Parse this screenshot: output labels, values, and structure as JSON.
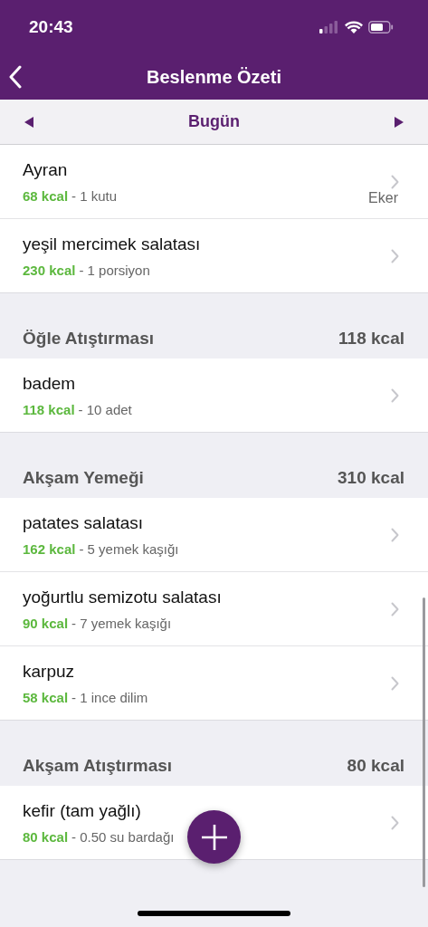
{
  "status_bar": {
    "time": "20:43"
  },
  "nav": {
    "title": "Beslenme Özeti"
  },
  "date_bar": {
    "label": "Bugün"
  },
  "sections": [
    {
      "items": [
        {
          "name": "Ayran",
          "kcal": "68 kcal",
          "serving": "- 1 kutu",
          "note": "Eker"
        },
        {
          "name": "yeşil mercimek salatası",
          "kcal": "230 kcal",
          "serving": "- 1 porsiyon"
        }
      ]
    },
    {
      "title": "Öğle Atıştırması",
      "total": "118 kcal",
      "items": [
        {
          "name": "badem",
          "kcal": "118 kcal",
          "serving": "- 10 adet"
        }
      ]
    },
    {
      "title": "Akşam Yemeği",
      "total": "310 kcal",
      "items": [
        {
          "name": "patates salatası",
          "kcal": "162 kcal",
          "serving": "- 5 yemek kaşığı"
        },
        {
          "name": "yoğurtlu semizotu salatası",
          "kcal": "90 kcal",
          "serving": "- 7 yemek kaşığı"
        },
        {
          "name": "karpuz",
          "kcal": "58 kcal",
          "serving": "- 1 ince dilim"
        }
      ]
    },
    {
      "title": "Akşam Atıştırması",
      "total": "80 kcal",
      "items": [
        {
          "name": "kefir (tam yağlı)",
          "kcal": "80 kcal",
          "serving": "- 0.50 su bardağı"
        }
      ]
    }
  ]
}
